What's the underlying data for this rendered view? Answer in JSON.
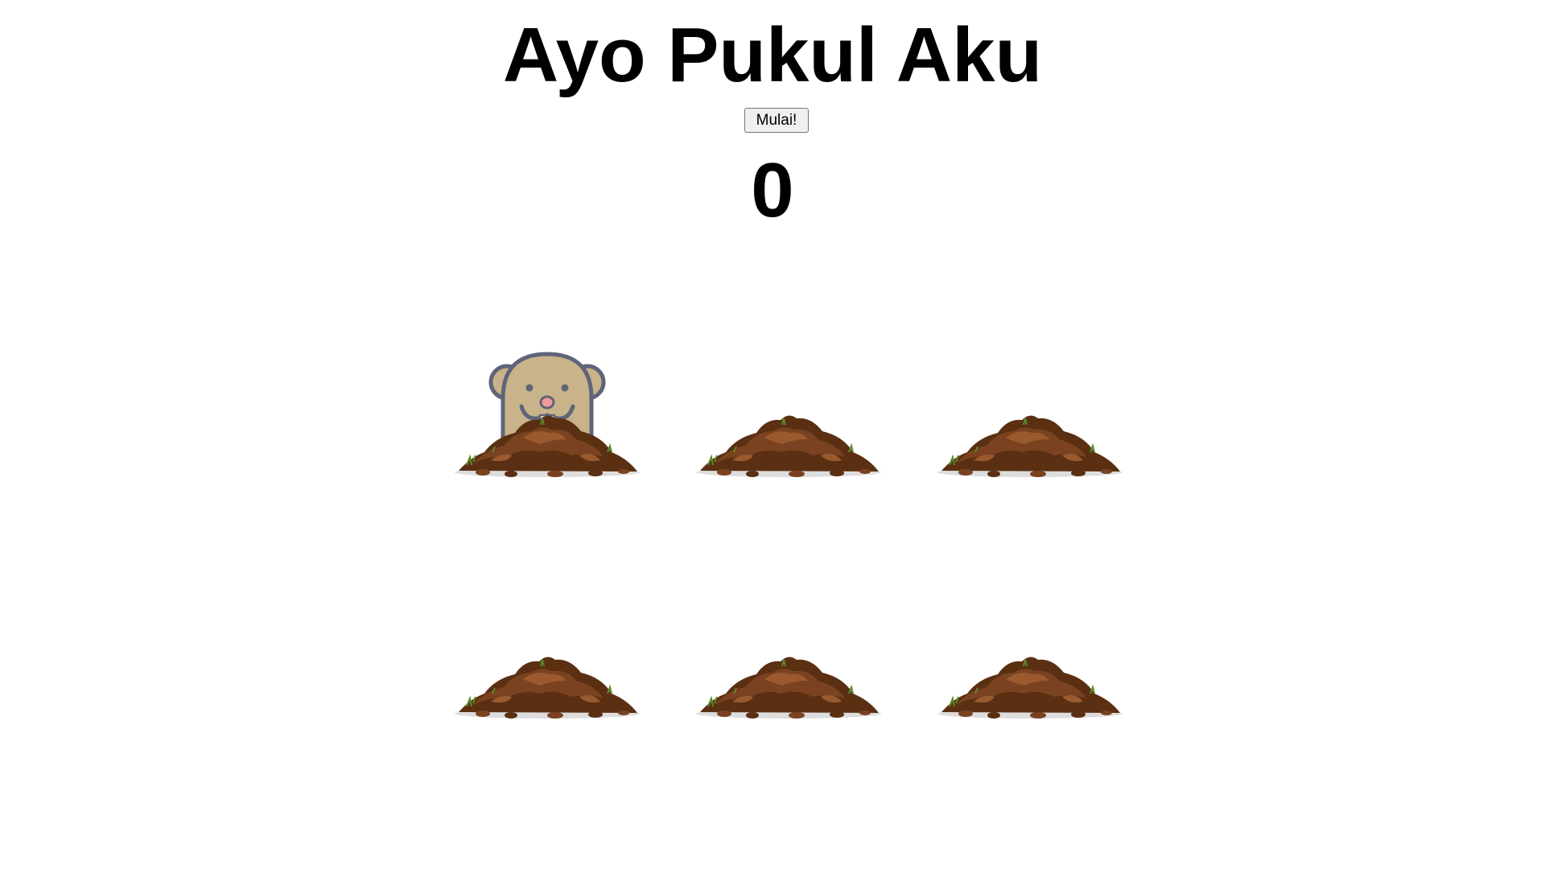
{
  "game": {
    "title": "Ayo Pukul Aku",
    "start_label": "Mulai!",
    "score": "0"
  },
  "holes": [
    {
      "index": 1,
      "mole_visible": true
    },
    {
      "index": 2,
      "mole_visible": false
    },
    {
      "index": 3,
      "mole_visible": false
    },
    {
      "index": 4,
      "mole_visible": false
    },
    {
      "index": 5,
      "mole_visible": false
    },
    {
      "index": 6,
      "mole_visible": false
    }
  ],
  "colors": {
    "mole_fur": "#c9b38a",
    "mole_outline": "#5f6478",
    "mole_nose": "#f2999d",
    "dirt_dark": "#5a2f12",
    "dirt_mid": "#7a4220",
    "dirt_light": "#9a5a2e",
    "grass": "#5a8a2a"
  }
}
